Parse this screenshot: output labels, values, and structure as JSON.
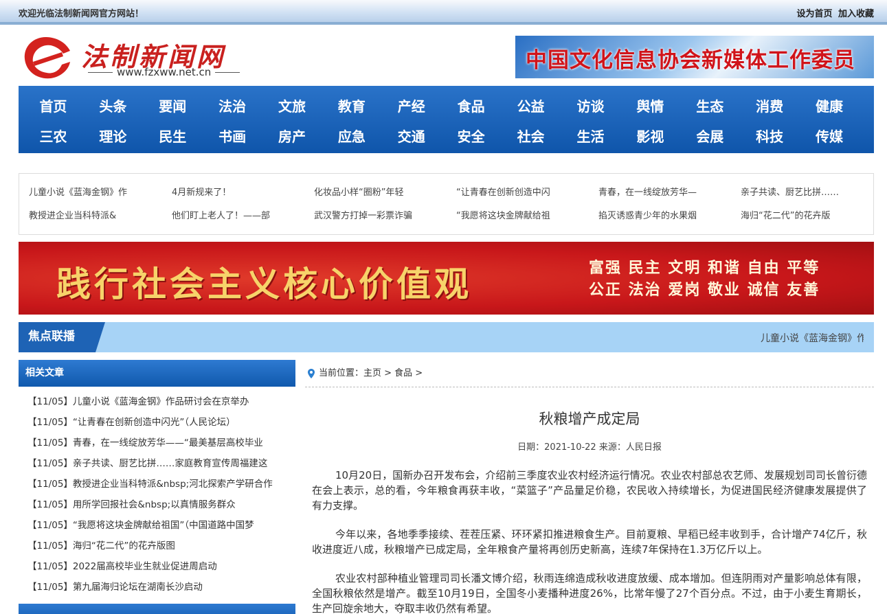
{
  "topbar": {
    "welcome": "欢迎光临法制新闻网官方网站！",
    "set_home": "设为首页",
    "add_favorite": "加入收藏"
  },
  "logo": {
    "name": "法制新闻网",
    "url": "www.fzxww.net.cn"
  },
  "banner_right": {
    "text": "中国文化信息协会新媒体工作委员会"
  },
  "nav": {
    "row1": [
      "首页",
      "头条",
      "要闻",
      "法治",
      "文旅",
      "教育",
      "产经",
      "食品",
      "公益",
      "访谈",
      "舆情",
      "生态",
      "消费",
      "健康"
    ],
    "row2": [
      "三农",
      "理论",
      "民生",
      "书画",
      "房产",
      "应急",
      "交通",
      "安全",
      "社会",
      "生活",
      "影视",
      "会展",
      "科技",
      "传媒"
    ]
  },
  "ticker": {
    "row1": [
      "儿童小说《蓝海金钢》作",
      "4月新规来了！",
      "化妆品小样“圈粉”年轻",
      "“让青春在创新创造中闪",
      "青春，在一线绽放芳华—",
      "亲子共读、厨艺比拼……"
    ],
    "row2": [
      "教授进企业当科特派&",
      "他们盯上老人了！——部",
      "武汉警方打掉一彩票诈骗",
      "“我愿将这块金牌献给祖",
      "掐灭诱惑青少年的水果烟",
      "海归“花二代”的花卉版"
    ]
  },
  "red_banner": {
    "main": "践行社会主义核心价值观",
    "values_line1": "富强 民主 文明 和谐 自由 平等",
    "values_line2": "公正 法治 爱岗 敬业 诚信 友善"
  },
  "focus": {
    "tag": "焦点联播",
    "scroll_text": "儿童小说《蓝海金钢》作"
  },
  "sidebar": {
    "heading": "相关文章",
    "items": [
      "【11/05】儿童小说《蓝海金钢》作品研讨会在京举办",
      "【11/05】“让青春在创新创造中闪光”（人民论坛）",
      "【11/05】青春，在一线绽放芳华——“最美基层高校毕业",
      "【11/05】亲子共读、厨艺比拼……家庭教育宣传周福建这",
      "【11/05】教授进企业当科特派&nbsp;河北探索产学研合作",
      "【11/05】用所学回报社会&nbsp;以真情服务群众",
      "【11/05】“我愿将这块金牌献给祖国”（中国道路中国梦",
      "【11/05】海归“花二代”的花卉版图",
      "【11/05】2022届高校毕业生就业促进周启动",
      "【11/05】第九届海归论坛在湖南长沙启动"
    ]
  },
  "article": {
    "breadcrumb": "当前位置：主页 > 食品 >",
    "title": "秋粮增产成定局",
    "meta": "日期：2021-10-22 来源：人民日报",
    "paragraphs": [
      "10月20日，国新办召开发布会，介绍前三季度农业农村经济运行情况。农业农村部总农艺师、发展规划司司长曾衍德在会上表示，总的看，今年粮食再获丰收，“菜篮子”产品量足价稳，农民收入持续增长，为促进国民经济健康发展提供了有力支撑。",
      "今年以来，各地季季接续、茬茬压紧、环环紧扣推进粮食生产。目前夏粮、早稻已经丰收到手，合计增产74亿斤，秋收进度近八成，秋粮增产已成定局，全年粮食产量将再创历史新高，连续7年保持在1.3万亿斤以上。",
      "农业农村部种植业管理司司长潘文博介绍，秋雨连绵造成秋收进度放缓、成本增加。但连阴雨对产量影响总体有限，全国秋粮依然是增产。截至10月19日，全国冬小麦播种进度26%，比常年慢了27个百分点。不过，由于小麦生育期长，生产回旋余地大，夺取丰收仍然有希望。"
    ]
  }
}
